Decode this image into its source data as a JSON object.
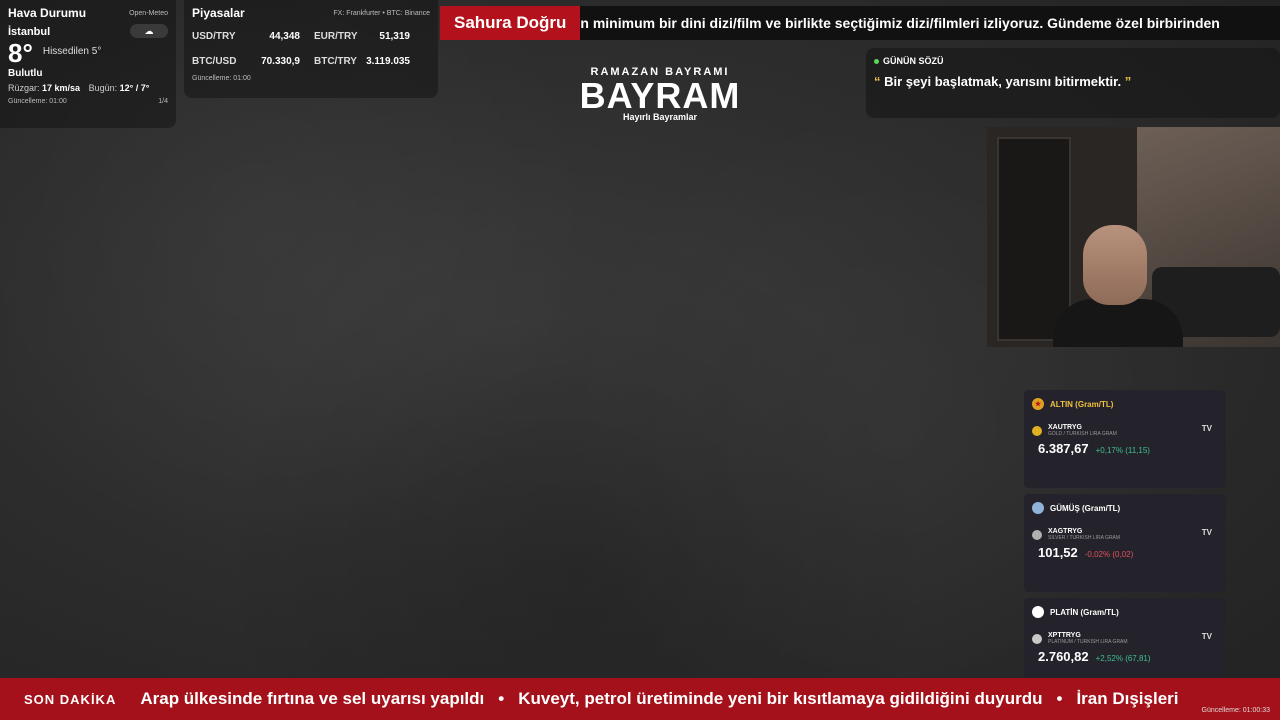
{
  "weather": {
    "title": "Hava Durumu",
    "source": "Open-Meteo",
    "city": "İstanbul",
    "icon": "cloud-icon",
    "temp": "8°",
    "feels_like": "Hissedilen 5°",
    "condition": "Bulutlu",
    "wind_label": "Rüzgar:",
    "wind_value": "17 km/sa",
    "today_label": "Bugün:",
    "today_value": "12° / 7°",
    "updated": "Güncelleme: 01:00",
    "page": "1/4"
  },
  "markets": {
    "title": "Piyasalar",
    "source": "FX: Frankfurter • BTC: Binance",
    "rows": [
      {
        "label1": "USD/TRY",
        "value1": "44,348",
        "label2": "EUR/TRY",
        "value2": "51,319"
      },
      {
        "label1": "BTC/USD",
        "value1": "70.330,9",
        "label2": "BTC/TRY",
        "value2": "3.119.035"
      }
    ],
    "updated": "Güncelleme: 01:00"
  },
  "top_ticker": {
    "tag": "Sahura Doğru",
    "text": "n minimum bir dini dizi/film ve birlikte seçtiğimiz dizi/filmleri izliyoruz. Gündeme özel birbirinden"
  },
  "center": {
    "subtitle": "RAMAZAN BAYRAMI",
    "title": "BAYRAM",
    "footer": "Hayırlı Bayramlar"
  },
  "quote": {
    "heading": "GÜNÜN SÖZÜ",
    "text": "Bir şeyi başlatmak, yarısını bitirmektir.",
    "open_mark": "“",
    "close_mark": "”"
  },
  "metals": [
    {
      "title": "ALTIN (Gram/TL)",
      "symbol": "XAUTRYG",
      "desc": "GOLD / TURKISH LIRA GRAM",
      "price": "6.387,67",
      "change": "+0,17% (11,15)",
      "change_color": "#3fbf8f",
      "coin_color": "#e0b020",
      "title_color": "#f0c040"
    },
    {
      "title": "GÜMÜŞ (Gram/TL)",
      "symbol": "XAGTRYG",
      "desc": "SILVER / TURKISH LIRA GRAM",
      "price": "101,52",
      "change": "-0,02% (0,02)",
      "change_color": "#e05060",
      "coin_color": "#b0b0b0",
      "title_color": "#ffffff"
    },
    {
      "title": "PLATİN (Gram/TL)",
      "symbol": "XPTTRYG",
      "desc": "PLATINUM / TURKISH LIRA GRAM",
      "price": "2.760,82",
      "change": "+2,52% (67,81)",
      "change_color": "#3fbf8f",
      "coin_color": "#c8c8c8",
      "title_color": "#ffffff"
    }
  ],
  "tv_logo": "TV",
  "bottom_ticker": {
    "tag": "SON DAKİKA",
    "items": [
      "Arap ülkesinde fırtına ve sel uyarısı yapıldı",
      "Kuveyt, petrol üretiminde yeni bir kısıtlamaya gidildiğini duyurdu",
      "İran Dışişleri"
    ],
    "separator": "•",
    "updated": "Güncelleme: 01:00:33"
  }
}
